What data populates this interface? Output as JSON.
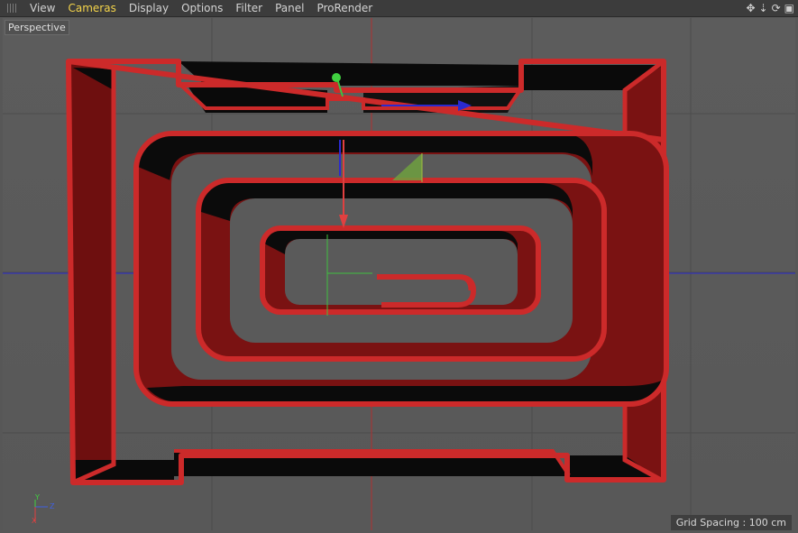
{
  "menu": {
    "items": [
      "View",
      "Cameras",
      "Display",
      "Options",
      "Filter",
      "Panel",
      "ProRender"
    ],
    "active_index": 1
  },
  "nav_icons": [
    {
      "name": "move-view-icon",
      "glyph": "✥"
    },
    {
      "name": "dolly-view-icon",
      "glyph": "⇣"
    },
    {
      "name": "rotate-view-icon",
      "glyph": "⟳"
    },
    {
      "name": "maximize-view-icon",
      "glyph": "▣"
    }
  ],
  "viewport": {
    "camera_label": "Perspective",
    "grid_spacing": "Grid Spacing : 100 cm"
  },
  "axis_gizmo": {
    "y_label": "Y",
    "z_label": "Z",
    "x_label": "X",
    "colors": {
      "x": "#e04040",
      "y": "#40d040",
      "z": "#4060e0"
    }
  },
  "scene": {
    "object_color": "#cc2a2a",
    "side_color": "#7a1010",
    "x_axis_color": "#2a2ad0",
    "y_axis_color": "#40c040",
    "z_axis_color": "#e04040"
  }
}
